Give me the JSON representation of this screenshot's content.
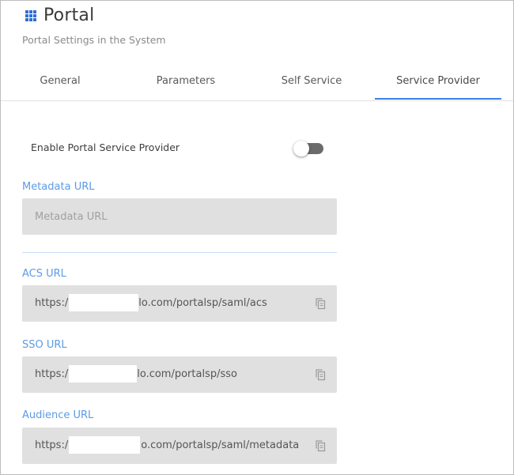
{
  "header": {
    "title": "Portal",
    "subtitle": "Portal Settings in the System",
    "icon": "grid-icon",
    "accent_color": "#2f6fd6"
  },
  "tabs": [
    {
      "label": "General",
      "active": false
    },
    {
      "label": "Parameters",
      "active": false
    },
    {
      "label": "Self Service",
      "active": false
    },
    {
      "label": "Service Provider",
      "active": true
    }
  ],
  "service_provider": {
    "enable_label": "Enable Portal Service Provider",
    "enabled": false,
    "metadata": {
      "label": "Metadata URL",
      "placeholder": "Metadata URL",
      "value": ""
    },
    "acs": {
      "label": "ACS URL",
      "prefix": "https:/",
      "suffix": "o.com/portalsp/saml/acs",
      "copy_icon": "copy-icon"
    },
    "sso": {
      "label": "SSO URL",
      "prefix": "https:/",
      "suffix": "o.com/portalsp/sso",
      "copy_icon": "copy-icon"
    },
    "audience": {
      "label": "Audience URL",
      "prefix": "https:/",
      "suffix": "o.com/portalsp/saml/metadata",
      "copy_icon": "copy-icon"
    }
  },
  "colors": {
    "label_blue": "#5b9be6",
    "tab_underline": "#3f7ee8",
    "field_bg": "#e0e0e0",
    "toggle_track": "#6b6b6b"
  }
}
